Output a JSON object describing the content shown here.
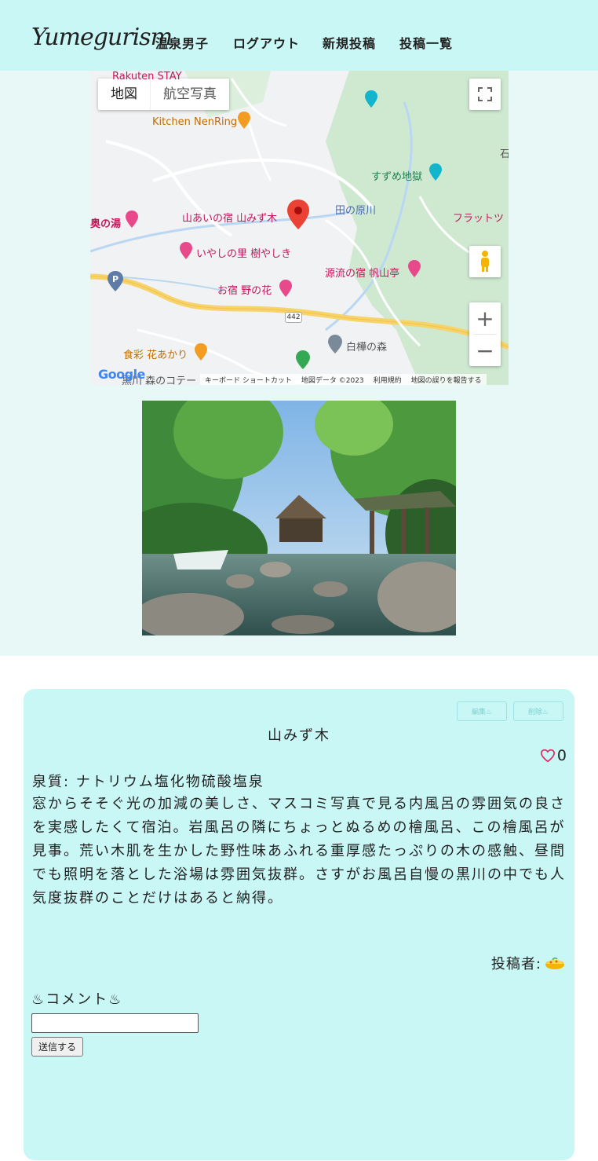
{
  "header": {
    "logo": "Yumegurism",
    "nav": [
      "温泉男子",
      "ログアウト",
      "新規投稿",
      "投稿一覧"
    ]
  },
  "map": {
    "type_buttons": [
      "地図",
      "航空写真"
    ],
    "labels": {
      "rakuten": "Rakuten STAY",
      "kitchen": "Kitchen NenRing",
      "okunoyu": "奥の湯",
      "yamamizuki": "山あいの宿 山みず木",
      "iyashi": "いやしの里 樹やしき",
      "nonohana": "お宿 野の花",
      "suzume": "すずめ地獄",
      "tanoharu": "田の原川",
      "flat": "フラットツ",
      "genryu": "源流の宿 帆山亭",
      "shirakaba": "白樺の森",
      "hanaakari": "食彩 花あかり",
      "cottage": "黒川 森のコテー",
      "route": "442",
      "ishi": "石"
    },
    "attribution": [
      "キーボード ショートカット",
      "地図データ ©2023",
      "利用規約",
      "地図の誤りを報告する"
    ],
    "google": "Google"
  },
  "post": {
    "edit_label": "編集♨",
    "delete_label": "削除♨",
    "title": "山みず木",
    "likes": "0",
    "spring_quality": "泉質: ナトリウム塩化物硫酸塩泉",
    "description": "窓からそそぐ光の加減の美しさ、マスコミ写真で見る内風呂の雰囲気の良さを実感したくて宿泊。岩風呂の隣にちょっとぬるめの檜風呂、この檜風呂が見事。荒い木肌を生かした野性味あふれる重厚感たっぷりの木の感触、昼間でも照明を落とした浴場は雰囲気抜群。さすがお風呂自慢の黒川の中でも人気度抜群のことだけはあると納得。",
    "author_label": "投稿者:"
  },
  "comment": {
    "heading": "♨コメント♨",
    "input_value": "",
    "submit_label": "送信する"
  }
}
